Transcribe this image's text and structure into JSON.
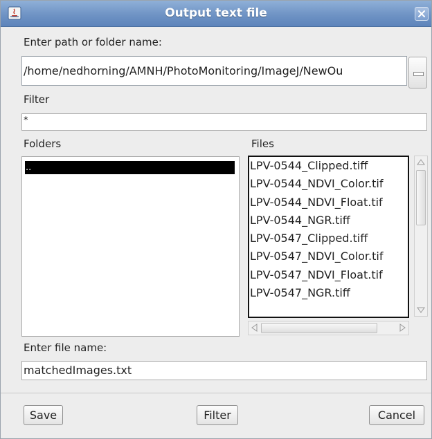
{
  "window": {
    "title": "Output text file"
  },
  "path": {
    "label": "Enter path or folder name:",
    "value": "/home/nedhorning/AMNH/PhotoMonitoring/ImageJ/NewOu"
  },
  "filter": {
    "label": "Filter",
    "value": "*"
  },
  "folders": {
    "label": "Folders",
    "items": [
      ".."
    ]
  },
  "files": {
    "label": "Files",
    "items": [
      "LPV-0544_Clipped.tiff",
      "LPV-0544_NDVI_Color.tif",
      "LPV-0544_NDVI_Float.tif",
      "LPV-0544_NGR.tiff",
      "LPV-0547_Clipped.tiff",
      "LPV-0547_NDVI_Color.tif",
      "LPV-0547_NDVI_Float.tif",
      "LPV-0547_NGR.tiff"
    ]
  },
  "filename": {
    "label": "Enter file name:",
    "value": "matchedImages.txt"
  },
  "buttons": {
    "save": "Save",
    "filter": "Filter",
    "cancel": "Cancel"
  },
  "colors": {
    "title_bar": "#6f93c4",
    "selection": "#000000",
    "background": "#ededed"
  }
}
